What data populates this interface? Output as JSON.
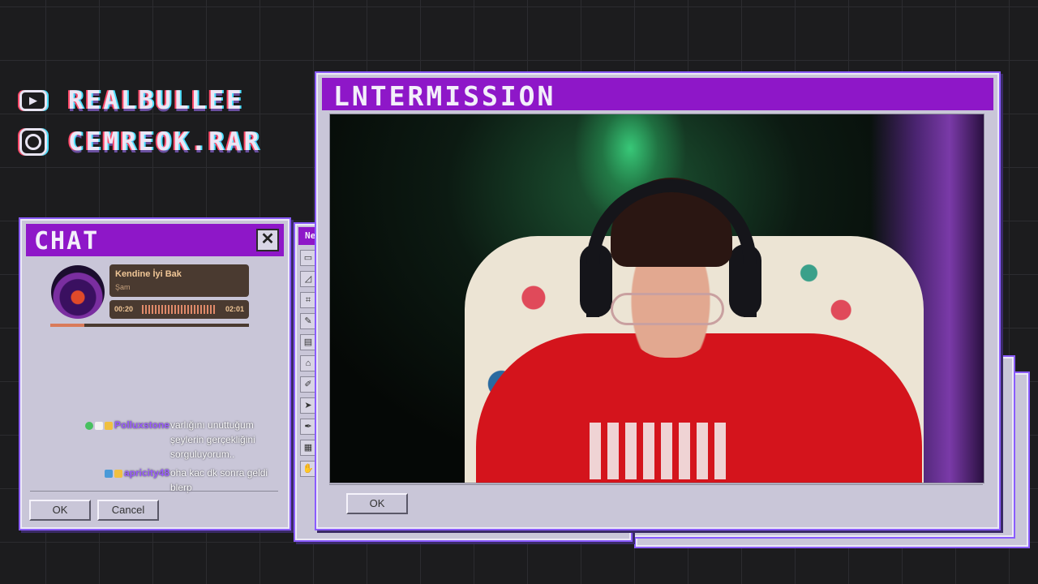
{
  "socials": [
    {
      "icon": "youtube-icon",
      "handle": "REALBULLEE"
    },
    {
      "icon": "instagram-icon",
      "handle": "CEMREOK.RAR"
    }
  ],
  "chat_window": {
    "title": "CHAT",
    "close_label": "✕",
    "now_playing": {
      "title": "Kendine İyi Bak",
      "artist": "Şam",
      "elapsed": "00:20",
      "duration": "02:01",
      "progress": 0.17
    },
    "messages": [
      {
        "user": "Polluxstone",
        "text_lines": [
          "varlığını unuttuğum",
          "şeylerin gerçekliğini",
          "sorguluyorum.."
        ]
      },
      {
        "user": "apricity48",
        "text_lines": [
          "oha kac dk sonra geldi",
          "blerp"
        ]
      }
    ],
    "ok_label": "OK",
    "cancel_label": "Cancel"
  },
  "paint_window": {
    "title": "Ne",
    "tools": [
      "▭",
      "◿",
      "⌗",
      "✎",
      "▤",
      "⌂",
      "✐",
      "➤",
      "✒",
      "▦",
      "✋"
    ]
  },
  "main_window": {
    "title": "LNTERMISSION",
    "ok_label": "OK"
  },
  "colors": {
    "titlebar": "#8e17c8",
    "window_bg": "#c9c6d8",
    "window_glow": "#8a5cff",
    "now_playing_card": "#4a3a30",
    "now_playing_text": "#f0c696"
  }
}
